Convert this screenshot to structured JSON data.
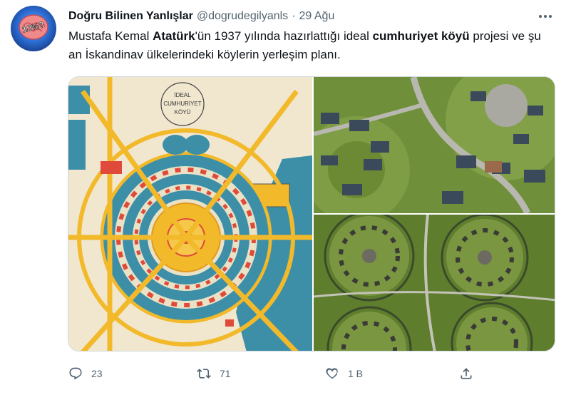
{
  "tweet": {
    "display_name": "Doğru Bilinen Yanlışlar",
    "handle": "@dogrudegilyanls",
    "separator": "·",
    "time": "29 Ağu",
    "avatar_text": "10%?",
    "text_parts": {
      "p1": "Mustafa Kemal ",
      "p2": "Atatürk",
      "p3": "'ün 1937 yılında hazırlattığı ideal ",
      "p4": "cumhuriyet köyü",
      "p5": " projesi ve şu an İskandinav ülkelerindeki köylerin yerleşim planı."
    }
  },
  "media": {
    "map_title_lines": [
      "İDEAL",
      "CUMHURİYET",
      "KÖYÜ"
    ],
    "images": [
      "ideal-village-plan-drawing",
      "circular-village-aerial-top",
      "circular-village-aerial-bottom"
    ]
  },
  "actions": {
    "reply": {
      "icon": "reply-icon",
      "count": "23"
    },
    "retweet": {
      "icon": "retweet-icon",
      "count": "71"
    },
    "like": {
      "icon": "heart-icon",
      "count": "1 B"
    },
    "share": {
      "icon": "share-icon"
    }
  },
  "colors": {
    "text": "#0f1419",
    "secondary": "#536471",
    "border": "#cfd9de",
    "plan_blue": "#3d8fa8",
    "plan_red": "#e04a3a",
    "plan_yellow": "#f2b92b",
    "grass": "#6f8f3a"
  }
}
